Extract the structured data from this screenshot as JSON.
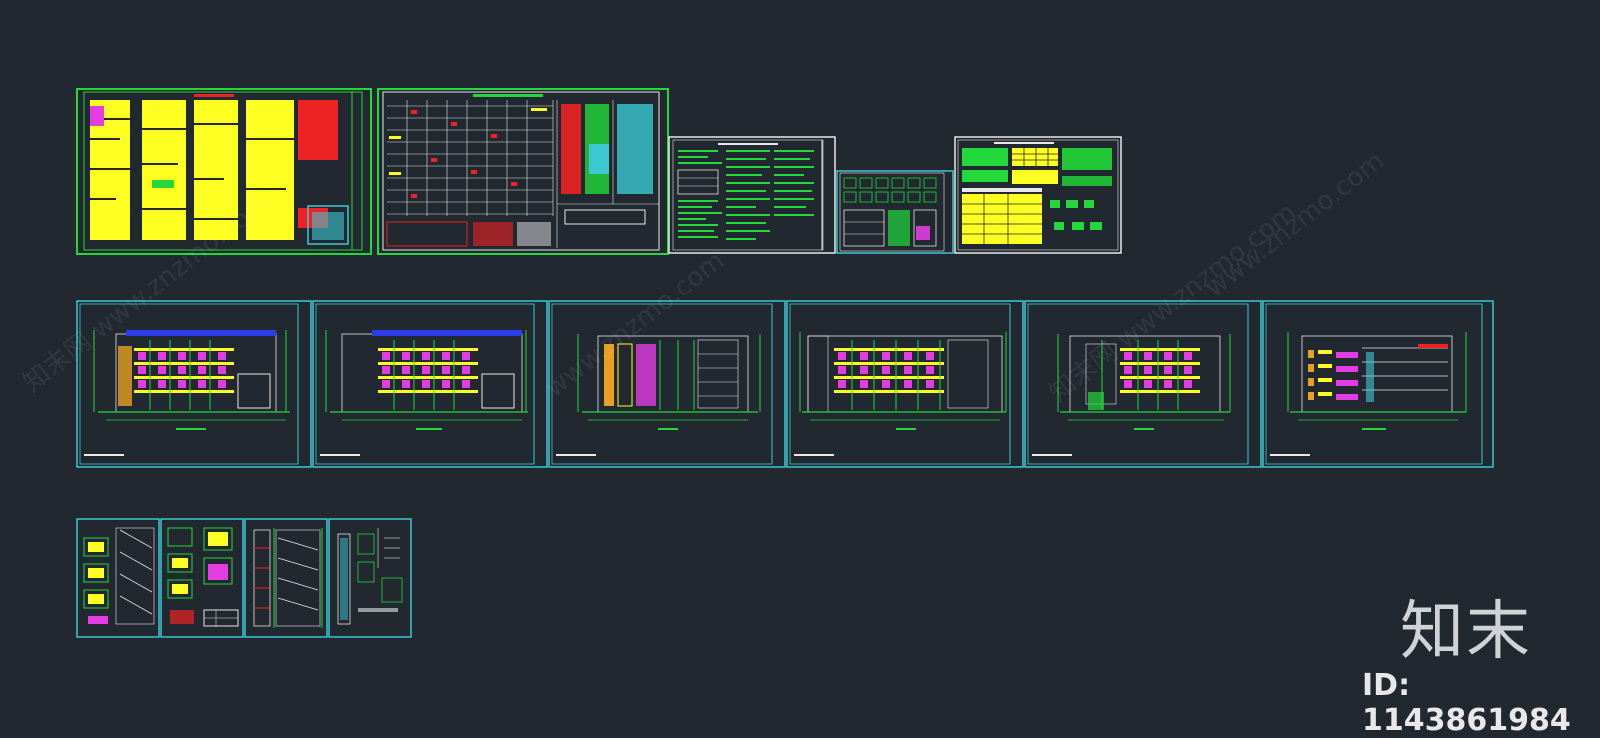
{
  "canvas": {
    "background": "#212830"
  },
  "watermarks": [
    "知末网 www.znzmo.com",
    "www.znzmo.com",
    "知末网 www.znzmo.com",
    "www.znzmo.com"
  ],
  "brand": {
    "logo_text": "知末",
    "id_text": "ID: 1143861984"
  },
  "colors": {
    "cyan": "#3cc8d2",
    "green": "#22d83a",
    "white": "#e8e8e8",
    "yellow": "#ffff22",
    "red": "#ee2222",
    "magenta": "#e23ce2",
    "blue": "#2a3ee8",
    "orange": "#e8a020"
  },
  "sheets": [
    {
      "name": "sheet-design-notes-1"
    },
    {
      "name": "sheet-design-notes-table"
    },
    {
      "name": "sheet-notes-white"
    },
    {
      "name": "sheet-detail-small"
    },
    {
      "name": "sheet-schedule"
    },
    {
      "name": "sheet-elevation-1"
    },
    {
      "name": "sheet-elevation-2"
    },
    {
      "name": "sheet-elevation-3"
    },
    {
      "name": "sheet-elevation-4"
    },
    {
      "name": "sheet-elevation-5"
    },
    {
      "name": "sheet-section-1"
    },
    {
      "name": "sheet-detail-a"
    },
    {
      "name": "sheet-detail-b"
    },
    {
      "name": "sheet-detail-c"
    },
    {
      "name": "sheet-detail-d"
    }
  ]
}
